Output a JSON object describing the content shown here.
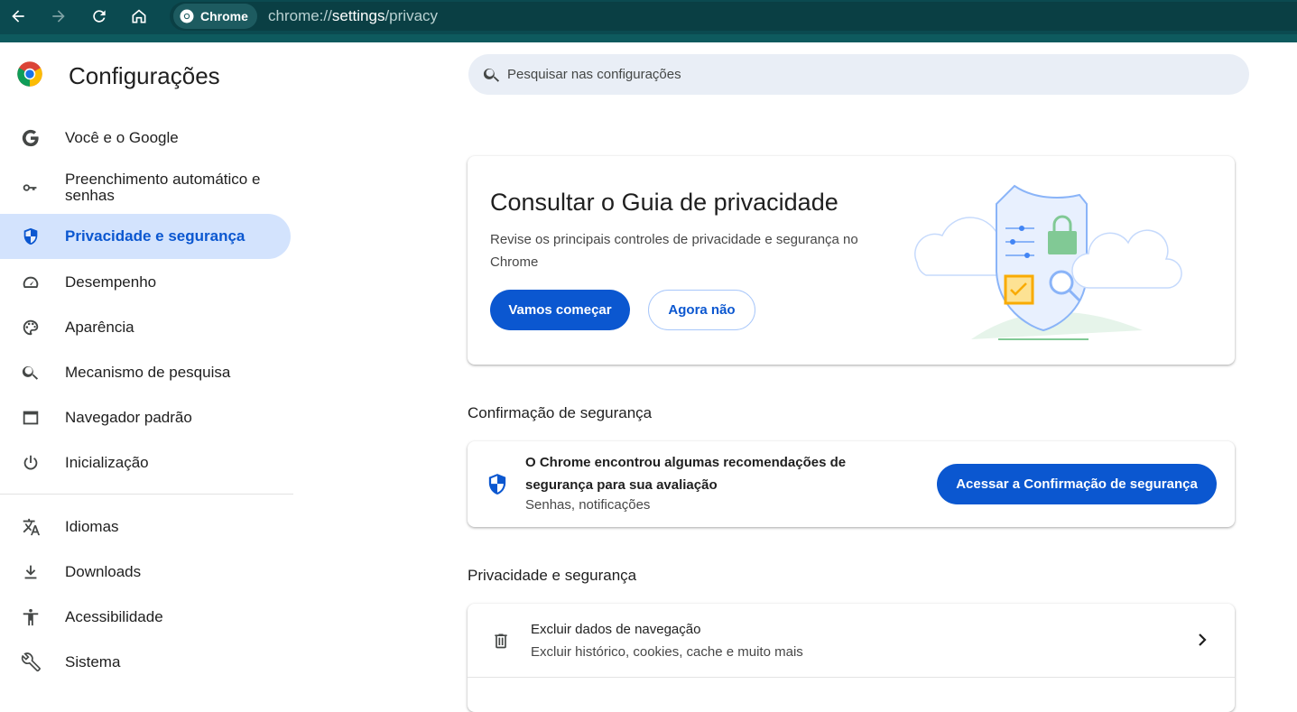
{
  "browser": {
    "chip_label": "Chrome",
    "url_scheme": "chrome://",
    "url_host": "settings",
    "url_path": "/privacy"
  },
  "sidebar": {
    "title": "Configurações",
    "items": [
      {
        "label": "Você e o Google",
        "icon": "google-g-icon"
      },
      {
        "label": "Preenchimento automático e senhas",
        "icon": "key-icon"
      },
      {
        "label": "Privacidade e segurança",
        "icon": "shield-icon",
        "active": true
      },
      {
        "label": "Desempenho",
        "icon": "speedometer-icon"
      },
      {
        "label": "Aparência",
        "icon": "palette-icon"
      },
      {
        "label": "Mecanismo de pesquisa",
        "icon": "search-icon"
      },
      {
        "label": "Navegador padrão",
        "icon": "browser-window-icon"
      },
      {
        "label": "Inicialização",
        "icon": "power-icon"
      },
      {
        "label": "Idiomas",
        "icon": "translate-icon"
      },
      {
        "label": "Downloads",
        "icon": "download-icon"
      },
      {
        "label": "Acessibilidade",
        "icon": "accessibility-icon"
      },
      {
        "label": "Sistema",
        "icon": "wrench-icon"
      }
    ]
  },
  "search": {
    "placeholder": "Pesquisar nas configurações"
  },
  "guide": {
    "title": "Consultar o Guia de privacidade",
    "description": "Revise os principais controles de privacidade e segurança no Chrome",
    "primary_label": "Vamos começar",
    "secondary_label": "Agora não"
  },
  "safety_check": {
    "section_title": "Confirmação de segurança",
    "message": "O Chrome encontrou algumas recomendações de segurança para sua avaliação",
    "detail": "Senhas, notificações",
    "button_label": "Acessar a Confirmação de segurança"
  },
  "privacy": {
    "section_title": "Privacidade e segurança",
    "rows": [
      {
        "title": "Excluir dados de navegação",
        "subtitle": "Excluir histórico, cookies, cache e muito mais"
      }
    ]
  },
  "colors": {
    "accent": "#0b57d0",
    "active_bg": "#d3e3fd",
    "topbar": "#0b4a50"
  }
}
